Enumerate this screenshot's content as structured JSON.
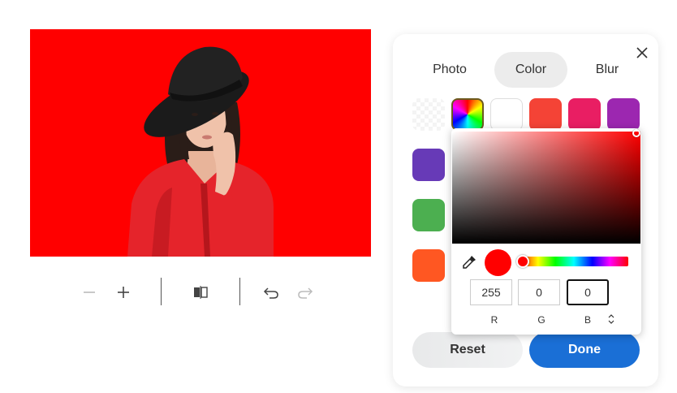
{
  "panel": {
    "tabs": [
      {
        "label": "Photo",
        "active": false
      },
      {
        "label": "Color",
        "active": true
      },
      {
        "label": "Blur",
        "active": false
      }
    ],
    "swatches_top": [
      "transparent",
      "rainbow",
      "#ffffff",
      "#f44336",
      "#e91e63",
      "#9c27b0"
    ],
    "swatches_left": [
      "#673ab7",
      "#4caf50",
      "#ff5722"
    ],
    "reset_label": "Reset",
    "done_label": "Done"
  },
  "picker": {
    "r": "255",
    "g": "0",
    "b": "0",
    "r_label": "R",
    "g_label": "G",
    "b_label": "B",
    "hue": "#ff0000"
  },
  "canvas": {
    "background": "#ff0000"
  }
}
